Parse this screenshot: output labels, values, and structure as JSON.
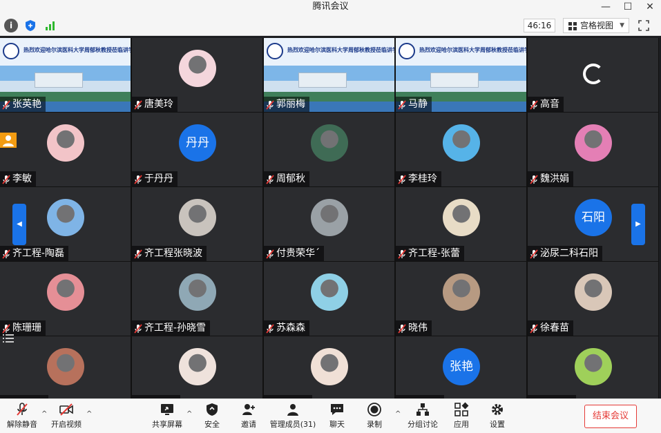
{
  "window": {
    "title": "腾讯会议",
    "minimize": "—",
    "maximize": "☐",
    "close": "✕"
  },
  "topbar": {
    "timer": "46:16",
    "view_label": "宫格视图",
    "view_caret": "▼"
  },
  "banner_text": "热烈欢迎哈尔滨医科大学周郁秋教授莅临讲学",
  "participants": [
    {
      "name": "张英艳",
      "kind": "banner"
    },
    {
      "name": "唐美玲",
      "kind": "photo",
      "color": "#f4d6dc"
    },
    {
      "name": "郭丽梅",
      "kind": "banner"
    },
    {
      "name": "马静",
      "kind": "banner"
    },
    {
      "name": "高音",
      "kind": "loading"
    },
    {
      "name": "李敏",
      "kind": "photo",
      "color": "#f2c4c8"
    },
    {
      "name": "于丹丹",
      "kind": "text",
      "initials": "丹丹"
    },
    {
      "name": "周郁秋",
      "kind": "photo",
      "color": "#3f6b55"
    },
    {
      "name": "李桂玲",
      "kind": "photo",
      "color": "#56b3e8"
    },
    {
      "name": "魏洪娟",
      "kind": "photo",
      "color": "#e47fb5"
    },
    {
      "name": "齐工程-陶磊",
      "kind": "photo",
      "color": "#7fb4e6"
    },
    {
      "name": "齐工程张晓波",
      "kind": "photo",
      "color": "#c9c3bd"
    },
    {
      "name": "付贵荣华´",
      "kind": "photo",
      "color": "#9aa1a6"
    },
    {
      "name": "齐工程-张蕾",
      "kind": "photo",
      "color": "#e8dcc6"
    },
    {
      "name": "泌尿二科石阳",
      "kind": "text",
      "initials": "石阳"
    },
    {
      "name": "陈珊珊",
      "kind": "photo",
      "color": "#e58f96"
    },
    {
      "name": "齐工程-孙晓雪",
      "kind": "photo",
      "color": "#8fa8b5"
    },
    {
      "name": "苏森森",
      "kind": "photo",
      "color": "#8fd0e6"
    },
    {
      "name": "晓伟",
      "kind": "photo",
      "color": "#b79a82"
    },
    {
      "name": "徐春苗",
      "kind": "photo",
      "color": "#d9c7b8"
    },
    {
      "name": "",
      "kind": "photo",
      "color": "#b7715c"
    },
    {
      "name": "",
      "kind": "photo",
      "color": "#efe2dc"
    },
    {
      "name": "",
      "kind": "photo",
      "color": "#f0e0d6"
    },
    {
      "name": "",
      "kind": "text",
      "initials": "张艳"
    },
    {
      "name": "",
      "kind": "photo",
      "color": "#9fd05a"
    }
  ],
  "toolbar": {
    "unmute": "解除静音",
    "video": "开启视频",
    "share": "共享屏幕",
    "security": "安全",
    "invite": "邀请",
    "members": "管理成员(31)",
    "chat": "聊天",
    "record": "录制",
    "breakout": "分组讨论",
    "apps": "应用",
    "settings": "设置",
    "end": "结束会议"
  },
  "colors": {
    "accent": "#1a73e8",
    "end": "#e53935",
    "muted": "#e53935"
  }
}
